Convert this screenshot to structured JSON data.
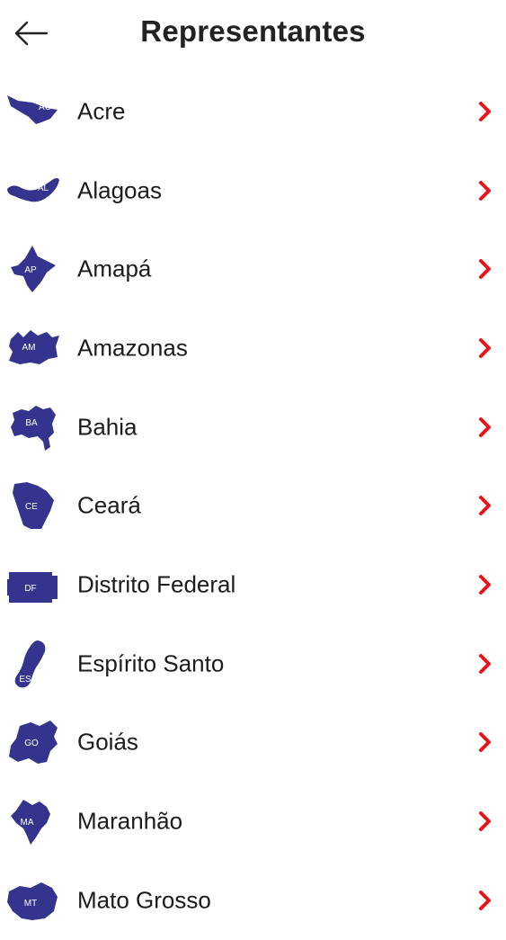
{
  "header": {
    "title": "Representantes",
    "back_icon": "arrow-left-icon"
  },
  "colors": {
    "map_fill": "#34348f",
    "chevron": "#e8141c",
    "text": "#1c1c1c"
  },
  "states": [
    {
      "name": "Acre",
      "abbr": "AC",
      "icon": "acre-map-icon"
    },
    {
      "name": "Alagoas",
      "abbr": "AL",
      "icon": "alagoas-map-icon"
    },
    {
      "name": "Amapá",
      "abbr": "AP",
      "icon": "amapa-map-icon"
    },
    {
      "name": "Amazonas",
      "abbr": "AM",
      "icon": "amazonas-map-icon"
    },
    {
      "name": "Bahia",
      "abbr": "BA",
      "icon": "bahia-map-icon"
    },
    {
      "name": "Ceará",
      "abbr": "CE",
      "icon": "ceara-map-icon"
    },
    {
      "name": "Distrito Federal",
      "abbr": "DF",
      "icon": "distrito-federal-map-icon"
    },
    {
      "name": "Espírito Santo",
      "abbr": "ES",
      "icon": "espirito-santo-map-icon"
    },
    {
      "name": "Goiás",
      "abbr": "GO",
      "icon": "goias-map-icon"
    },
    {
      "name": "Maranhão",
      "abbr": "MA",
      "icon": "maranhao-map-icon"
    },
    {
      "name": "Mato Grosso",
      "abbr": "MT",
      "icon": "mato-grosso-map-icon"
    }
  ]
}
